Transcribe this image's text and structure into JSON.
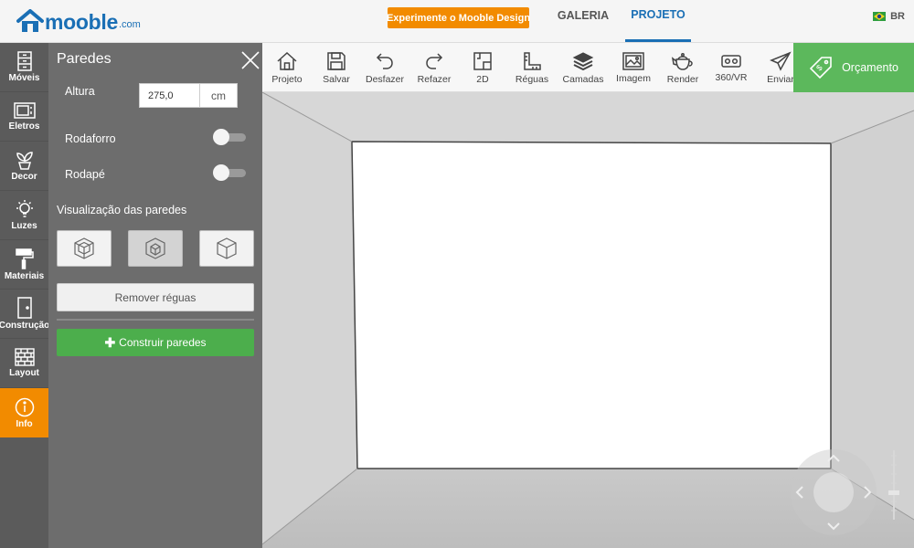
{
  "header": {
    "logo_word": "mooble",
    "logo_suffix": ".com",
    "promo_label": "Experimente o Mooble Design",
    "tabs": [
      {
        "label": "GALERIA",
        "active": false
      },
      {
        "label": "PROJETO",
        "active": true
      }
    ],
    "language": "BR"
  },
  "sidebar": {
    "items": [
      {
        "label": "Móveis",
        "icon": "cabinet-icon"
      },
      {
        "label": "Eletros",
        "icon": "microwave-icon"
      },
      {
        "label": "Decor",
        "icon": "plant-icon"
      },
      {
        "label": "Luzes",
        "icon": "lightbulb-icon"
      },
      {
        "label": "Materiais",
        "icon": "paint-roller-icon"
      },
      {
        "label": "Construção",
        "icon": "door-icon"
      },
      {
        "label": "Layout",
        "icon": "brick-wall-icon"
      },
      {
        "label": "Info",
        "icon": "info-icon",
        "active": true
      }
    ]
  },
  "panel": {
    "title": "Paredes",
    "altura_label": "Altura",
    "altura_value": "275,0",
    "altura_unit": "cm",
    "rodaforro_label": "Rodaforro",
    "rodape_label": "Rodapé",
    "visualizacao_label": "Visualização das paredes",
    "remover_label": "Remover réguas",
    "construir_label": "Construir paredes"
  },
  "toolbar": {
    "items": [
      {
        "label": "Projeto",
        "icon": "home-icon"
      },
      {
        "label": "Salvar",
        "icon": "save-icon"
      },
      {
        "label": "Desfazer",
        "icon": "undo-icon"
      },
      {
        "label": "Refazer",
        "icon": "redo-icon"
      },
      {
        "label": "2D",
        "icon": "floorplan-icon"
      },
      {
        "label": "Réguas",
        "icon": "ruler-icon"
      },
      {
        "label": "Camadas",
        "icon": "layers-icon"
      },
      {
        "label": "Imagem",
        "icon": "image-icon"
      },
      {
        "label": "Render",
        "icon": "teapot-icon"
      },
      {
        "label": "360/VR",
        "icon": "vr-headset-icon"
      },
      {
        "label": "Enviar",
        "icon": "send-icon"
      }
    ],
    "orcamento_label": "Orçamento"
  },
  "colors": {
    "brand_blue": "#1a6fb5",
    "accent_orange": "#f28b00",
    "green": "#5cb85c",
    "sidebar_bg": "#5b5b5b",
    "panel_bg": "#6d6d6d"
  }
}
